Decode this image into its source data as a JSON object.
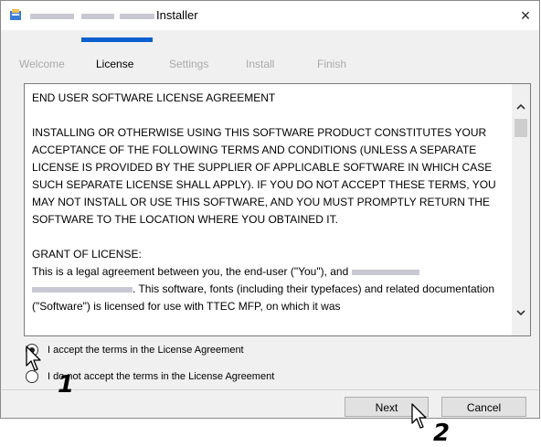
{
  "window": {
    "title": "Installer",
    "close_glyph": "×",
    "icon": "installer-app-icon"
  },
  "steps": [
    {
      "label": "Welcome"
    },
    {
      "label": "License"
    },
    {
      "label": "Settings"
    },
    {
      "label": "Install"
    },
    {
      "label": "Finish"
    }
  ],
  "active_step": "License",
  "license": {
    "heading": "END USER SOFTWARE LICENSE AGREEMENT",
    "paragraph1": "INSTALLING OR OTHERWISE USING THIS SOFTWARE PRODUCT CONSTITUTES YOUR ACCEPTANCE OF THE FOLLOWING TERMS AND CONDITIONS (UNLESS A SEPARATE LICENSE IS PROVIDED BY THE SUPPLIER OF APPLICABLE SOFTWARE IN WHICH CASE SUCH SEPARATE LICENSE SHALL APPLY). IF YOU DO NOT ACCEPT THESE TERMS, YOU MAY NOT INSTALL OR USE THIS SOFTWARE, AND YOU MUST PROMPTLY RETURN THE SOFTWARE TO THE LOCATION WHERE YOU OBTAINED IT.",
    "grant_heading": "GRANT OF LICENSE:",
    "grant_part1": "This is a legal agreement between you, the end-user (\"You\"), and",
    "grant_part2": ". This software, fonts (including their typefaces) and related documentation (\"Software\") is licensed for use with TTEC MFP, on which it was"
  },
  "options": {
    "accept_label": "I accept the terms in the License Agreement",
    "decline_label": "I do not accept the terms in the License Agreement",
    "selected": "accept"
  },
  "buttons": {
    "next_label": "Next",
    "cancel_label": "Cancel"
  },
  "annotations": {
    "marker1": "1",
    "marker2": "2"
  },
  "colors": {
    "progress_accent": "#0a5fd1",
    "inactive_step": "#aaaaaa",
    "redaction": "#c8c8d4"
  }
}
